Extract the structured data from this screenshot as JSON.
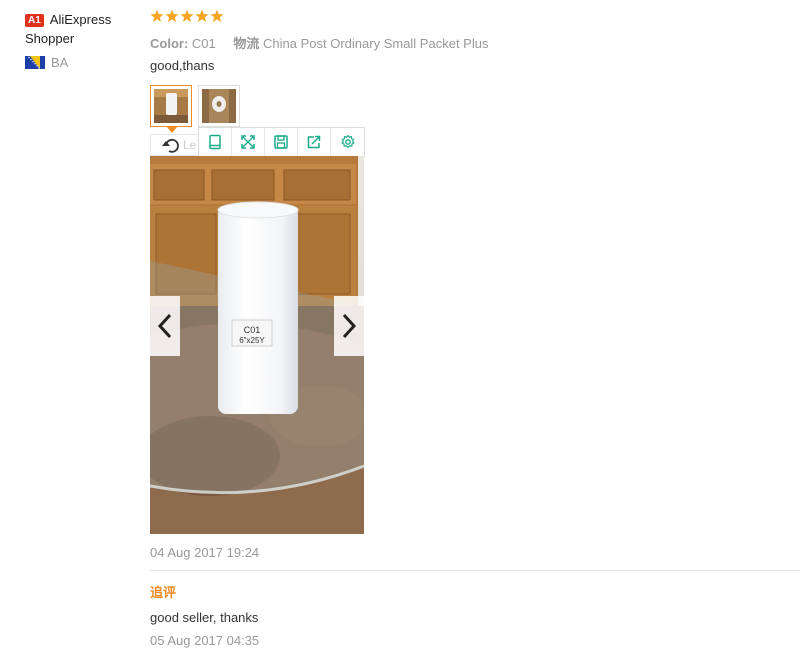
{
  "user": {
    "badge": "A1",
    "name": "AliExpress Shopper",
    "country": "BA",
    "flag_icon": "bosnia-flag"
  },
  "review": {
    "rating": 5,
    "star_color": "#f5a623",
    "color_key": "Color:",
    "color_value": "C01",
    "logistics_key": "物流",
    "logistics_value": "China Post Ordinary Small Packet Plus",
    "text": "good,thans",
    "date": "04 Aug 2017 19:24",
    "rotate_label": "Le",
    "photo_label": "C01\n6\"x25Y"
  },
  "toolbar": {
    "icons": [
      "fit-page-icon",
      "fullscreen-icon",
      "save-icon",
      "share-icon",
      "settings-icon"
    ],
    "icon_color": "#1aab8a"
  },
  "followup": {
    "title": "追评",
    "text": "good seller, thanks",
    "date": "05 Aug 2017 04:35"
  }
}
